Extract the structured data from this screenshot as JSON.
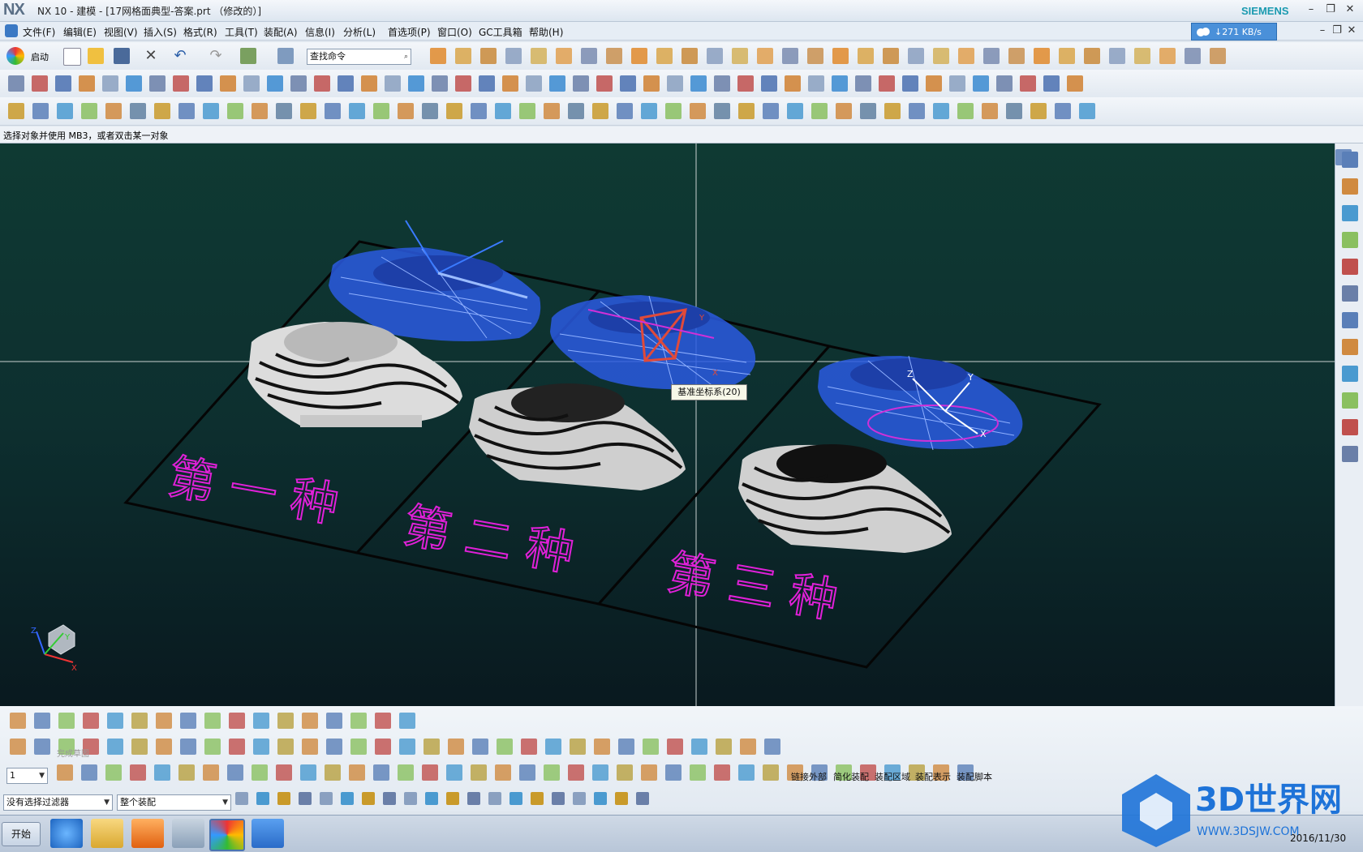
{
  "app": {
    "logo": "NX",
    "title": "NX 10 - 建模 - [17网格面典型-答案.prt （修改的）]",
    "brand": "SIEMENS",
    "brand_color": "#1a9ab0"
  },
  "menu": {
    "items": [
      "文件(F)",
      "编辑(E)",
      "视图(V)",
      "插入(S)",
      "格式(R)",
      "工具(T)",
      "装配(A)",
      "信息(I)",
      "分析(L)",
      "首选项(P)",
      "窗口(O)",
      "GC工具箱",
      "帮助(H)"
    ],
    "net_speed": "↓271 KB/s"
  },
  "toolbar": {
    "start_label": "启动",
    "search_placeholder": "查找命令"
  },
  "status": {
    "prompt": "选择对象并使用 MB3，或者双击某一对象"
  },
  "viewport": {
    "background_top": "#0f3a33",
    "background_bottom": "#09191f",
    "mesh_color": "#2a5be0",
    "text_color": "#e020d8",
    "labels": [
      "第 一 种",
      "第 二 种",
      "第 三 种"
    ],
    "tooltip": "基准坐标系(20)",
    "axis_labels": {
      "x": "X",
      "y": "Y",
      "z": "Z"
    },
    "triad_labels": {
      "x": "X",
      "y": "Y",
      "z": "Z"
    }
  },
  "bottom": {
    "sketch_finish": "完成草图",
    "layer_value": "1",
    "filter_value": "没有选择过滤器",
    "scope_value": "整个装配",
    "assembly_tools": [
      "链接外部",
      "简化装配",
      "装配区域",
      "装配表示",
      "装配脚本"
    ]
  },
  "taskbar": {
    "start": "开始",
    "date": "2016/11/30"
  },
  "watermark": {
    "text": "3D世界网",
    "url": "WWW.3DSJW.COM"
  }
}
